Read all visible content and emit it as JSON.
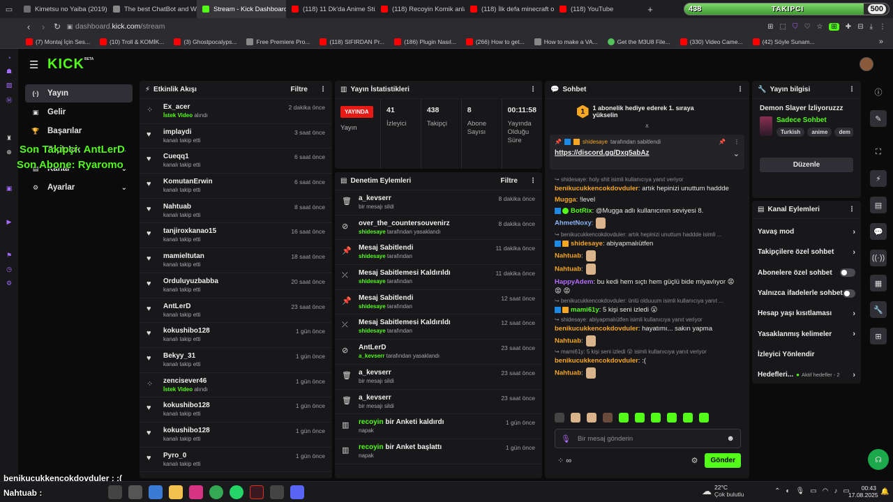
{
  "browser": {
    "tabs": [
      {
        "label": "Kimetsu no Yaiba (2019) 1",
        "color": "#6d6d72"
      },
      {
        "label": "The best ChatBot and W",
        "color": "#888"
      },
      {
        "label": "Stream - Kick Dashboard",
        "color": "#53fc18"
      },
      {
        "label": "(118) 11 Dk'da Anime Stüd",
        "color": "#ff0000"
      },
      {
        "label": "(118) Recoyin Komik anla",
        "color": "#ff0000"
      },
      {
        "label": "(118) İlk defa minecraft o",
        "color": "#ff0000"
      },
      {
        "label": "(118) YouTube",
        "color": "#ff0000"
      }
    ],
    "new_tab": "+",
    "url_domain": "dashboard.",
    "url_host": "kick.com",
    "url_path": "/stream",
    "bookmarks": [
      "(7) Montaj İçin Ses...",
      "(10) Troll & KOMİK...",
      "(3) Ghostpocalyps...",
      "Free Premiere Pro...",
      "(118) SIFIRDAN Pr...",
      "(186) Plugin Nasıl...",
      "(266) How to get...",
      "How to make a VA...",
      "Get the M3U8 File...",
      "(330) Video Came...",
      "(42) Söyle Sunam..."
    ],
    "bookmarks_more": "»"
  },
  "follower_bar": {
    "current": "438",
    "label": "TAKIPCI",
    "goal": "500",
    "progress": 0.876
  },
  "app": {
    "logo": "KICK",
    "logo_badge": "BETA"
  },
  "nav": [
    {
      "label": "Yayın",
      "icon": "stream-icon",
      "glyph": "(·)"
    },
    {
      "label": "Gelir",
      "icon": "revenue-icon",
      "glyph": "▣"
    },
    {
      "label": "Başarılar",
      "icon": "trophy-icon",
      "glyph": "🏆"
    },
    {
      "label": "Topluluk",
      "icon": "community-icon",
      "glyph": "☺"
    },
    {
      "label": "Kanal",
      "icon": "channel-icon",
      "glyph": "▤"
    },
    {
      "label": "Ayarlar",
      "icon": "settings-icon",
      "glyph": "⚙"
    }
  ],
  "activity": {
    "title": "Etkinlik Akışı",
    "filter": "Filtre",
    "items": [
      {
        "name": "Ex_acer",
        "sub": "İstek Video",
        "sub2": " alındı",
        "time": "2 dakika önce",
        "kind": "request"
      },
      {
        "name": "implaydi",
        "sub": "kanalı takip etti",
        "time": "3 saat önce",
        "kind": "follow"
      },
      {
        "name": "Cueqq1",
        "sub": "kanalı takip etti",
        "time": "6 saat önce",
        "kind": "follow"
      },
      {
        "name": "KomutanErwin",
        "sub": "kanalı takip etti",
        "time": "6 saat önce",
        "kind": "follow"
      },
      {
        "name": "Nahtuab",
        "sub": "kanalı takip etti",
        "time": "8 saat önce",
        "kind": "follow"
      },
      {
        "name": "tanjiroxkanao15",
        "sub": "kanalı takip etti",
        "time": "16 saat önce",
        "kind": "follow"
      },
      {
        "name": "mamieltutan",
        "sub": "kanalı takip etti",
        "time": "18 saat önce",
        "kind": "follow"
      },
      {
        "name": "Orduluyuzbabba",
        "sub": "kanalı takip etti",
        "time": "20 saat önce",
        "kind": "follow"
      },
      {
        "name": "AntLerD",
        "sub": "kanalı takip etti",
        "time": "23 saat önce",
        "kind": "follow"
      },
      {
        "name": "kokushibo128",
        "sub": "kanalı takip etti",
        "time": "1 gün önce",
        "kind": "follow"
      },
      {
        "name": "Bekyy_31",
        "sub": "kanalı takip etti",
        "time": "1 gün önce",
        "kind": "follow"
      },
      {
        "name": "zencisever46",
        "sub": "İstek Video",
        "sub2": " alındı",
        "time": "1 gün önce",
        "kind": "request"
      },
      {
        "name": "kokushibo128",
        "sub": "kanalı takip etti",
        "time": "1 gün önce",
        "kind": "follow"
      },
      {
        "name": "kokushibo128",
        "sub": "kanalı takip etti",
        "time": "1 gün önce",
        "kind": "follow"
      },
      {
        "name": "Pyro_0",
        "sub": "kanalı takip etti",
        "time": "1 gün önce",
        "kind": "follow"
      }
    ]
  },
  "stats": {
    "title": "Yayın İstatistikleri",
    "live_badge": "YAYINDA",
    "live_label": "Yayın",
    "cells": [
      {
        "value": "41",
        "label": "İzleyici"
      },
      {
        "value": "438",
        "label": "Takipçi"
      },
      {
        "value": "8",
        "label": "Abone Sayısı"
      },
      {
        "value": "00:11:58",
        "label": "Yayında Olduğu Süre"
      }
    ]
  },
  "moderation": {
    "title": "Denetim Eylemleri",
    "filter": "Filtre",
    "items": [
      {
        "name": "a_kevserr",
        "who": "",
        "rest": "bir mesajı sildi",
        "time": "8 dakika önce",
        "icon": "trash-icon",
        "glyph": "🗑"
      },
      {
        "name": "over_the_countersouvenirz",
        "who": "shidesaye",
        "rest": " tarafından yasaklandı",
        "time": "8 dakika önce",
        "icon": "ban-icon",
        "glyph": "⊘"
      },
      {
        "name": "Mesaj Sabitlendi",
        "who": "shidesaye",
        "rest": " tarafından",
        "time": "11 dakika önce",
        "icon": "pin-icon",
        "glyph": "📌"
      },
      {
        "name": "Mesaj Sabitlemesi Kaldırıldı",
        "who": "shidesaye",
        "rest": " tarafından",
        "time": "11 dakika önce",
        "icon": "unpin-icon",
        "glyph": "⤫"
      },
      {
        "name": "Mesaj Sabitlendi",
        "who": "shidesaye",
        "rest": " tarafından",
        "time": "12 saat önce",
        "icon": "pin-icon",
        "glyph": "📌"
      },
      {
        "name": "Mesaj Sabitlemesi Kaldırıldı",
        "who": "shidesaye",
        "rest": " tarafından",
        "time": "12 saat önce",
        "icon": "unpin-icon",
        "glyph": "⤫"
      },
      {
        "name": "AntLerD",
        "who": "a_kevserr",
        "rest": " tarafından yasaklandı",
        "time": "23 saat önce",
        "icon": "ban-icon",
        "glyph": "⊘"
      },
      {
        "name": "a_kevserr",
        "who": "",
        "rest": "bir mesajı sildi",
        "time": "23 saat önce",
        "icon": "trash-icon",
        "glyph": "🗑"
      },
      {
        "name": "a_kevserr",
        "who": "",
        "rest": "bir mesajı sildi",
        "time": "23 saat önce",
        "icon": "trash-icon",
        "glyph": "🗑"
      },
      {
        "name": "recoyin",
        "name2": " bir Anketi kaldırdı",
        "who": "",
        "rest": "napak",
        "time": "1 gün önce",
        "icon": "poll-icon",
        "glyph": "▥",
        "green": true
      },
      {
        "name": "recoyin",
        "name2": " bir Anket başlattı",
        "who": "",
        "rest": "napak",
        "time": "1 gün önce",
        "icon": "poll-icon",
        "glyph": "▥",
        "green": true
      }
    ]
  },
  "chat": {
    "title": "Sohbet",
    "promo": "1 abonelik hediye ederek 1. sıraya yükselin",
    "promo_badge": "1",
    "pinned_by": "shidesaye",
    "pinned_suffix": " tarafından sabitlendi",
    "pinned_link": "https://discord.gg/Dxq5abAz",
    "messages": [
      {
        "reply": "shidesaye: holy shit isimli kullanıcıya yanıt veriyor"
      },
      {
        "user": "benikucukkencokdovduler",
        "color": "#f5a623",
        "text": ": artık hepinizi unuttum haddde"
      },
      {
        "user": "Mugga",
        "color": "#f5a623",
        "text": ": !level"
      },
      {
        "user": "BotRix",
        "color": "#53fc18",
        "text": ": @Mugga adlı kullanıcının seviyesi 8.",
        "badges": true
      },
      {
        "user": "AhmetNoxy",
        "color": "#8ab4f8",
        "text": ":",
        "emote": true
      },
      {
        "reply": "benikucukkencokdovduler: artık hepinizi unuttum haddde isimli ..."
      },
      {
        "user": "shidesaye",
        "color": "#f5a623",
        "text": ": abiyapmalıütfen",
        "badges": true
      },
      {
        "user": "Nahtuab",
        "color": "#f5a623",
        "text": ":",
        "emote": true
      },
      {
        "user": "Nahtuab",
        "color": "#f5a623",
        "text": ":",
        "emote": true
      },
      {
        "user": "HappyAdem",
        "color": "#b56cff",
        "text": ": bu kedi hem sıçtı hem güçlü bide miyavlıyor 😡 😡 😡"
      },
      {
        "reply": "benikucukkencokdovduler: ünlü olduuum isimli kullanıcıya yanıt ..."
      },
      {
        "user": "mami61y",
        "color": "#53fc18",
        "text": ": 5 kişi seni izledi 😮",
        "badges": true
      },
      {
        "reply": "shidesaye: abiyapmalıütfen isimli kullanıcıya yanıt veriyor"
      },
      {
        "user": "benikucukkencokdovduler",
        "color": "#f5a623",
        "text": ": hayatımı... sakın yapma"
      },
      {
        "user": "Nahtuab",
        "color": "#f5a623",
        "text": ":",
        "emote": true
      },
      {
        "reply": "mami61y: 5 kişi seni izledi 😮 isimli kullanıcıya yanıt veriyor"
      },
      {
        "user": "benikucukkencokdovduler",
        "color": "#f5a623",
        "text": ": :("
      },
      {
        "user": "Nahtuab",
        "color": "#f5a623",
        "text": ":",
        "emote": true
      }
    ],
    "input_placeholder": "Bir mesaj gönderin",
    "send_label": "Gönder"
  },
  "stream_info": {
    "title": "Yayın bilgisi",
    "stream_title": "Demon Slayer İzliyoruzzz",
    "mode": "Sadece Sohbet",
    "tags": [
      "Turkish",
      "anime",
      "dem"
    ],
    "edit_label": "Düzenle"
  },
  "channel_actions": {
    "title": "Kanal Eylemleri",
    "items": [
      {
        "label": "Yavaş mod",
        "control": "chevron"
      },
      {
        "label": "Takipçilere özel sohbet",
        "control": "chevron"
      },
      {
        "label": "Abonelere özel sohbet",
        "control": "toggle"
      },
      {
        "label": "Yalnızca ifadelerle sohbet",
        "control": "toggle"
      },
      {
        "label": "Hesap yaşı kısıtlaması",
        "control": "chevron"
      },
      {
        "label": "Yasaklanmış kelimeler",
        "control": "chevron"
      },
      {
        "label": "İzleyici Yönlendir",
        "control": "none"
      },
      {
        "label": "Hedefleri...",
        "control": "goal",
        "extra": "Aktif hedefler - 2"
      }
    ]
  },
  "overlays": {
    "last_follower": "Son Takipçi: AntLerD",
    "last_sub": "Son Abone: Ryaromo",
    "chat_line1": "benikucukkencokdovduler : :(",
    "chat_line2": "Nahtuab :"
  },
  "taskbar": {
    "weather_temp": "22°C",
    "weather_desc": "Çok bulutlu",
    "time": "00:43",
    "date": "17.08.2025"
  },
  "colors": {
    "kick_green": "#53fc18",
    "panel": "#18181b",
    "live_red": "#e91916"
  }
}
